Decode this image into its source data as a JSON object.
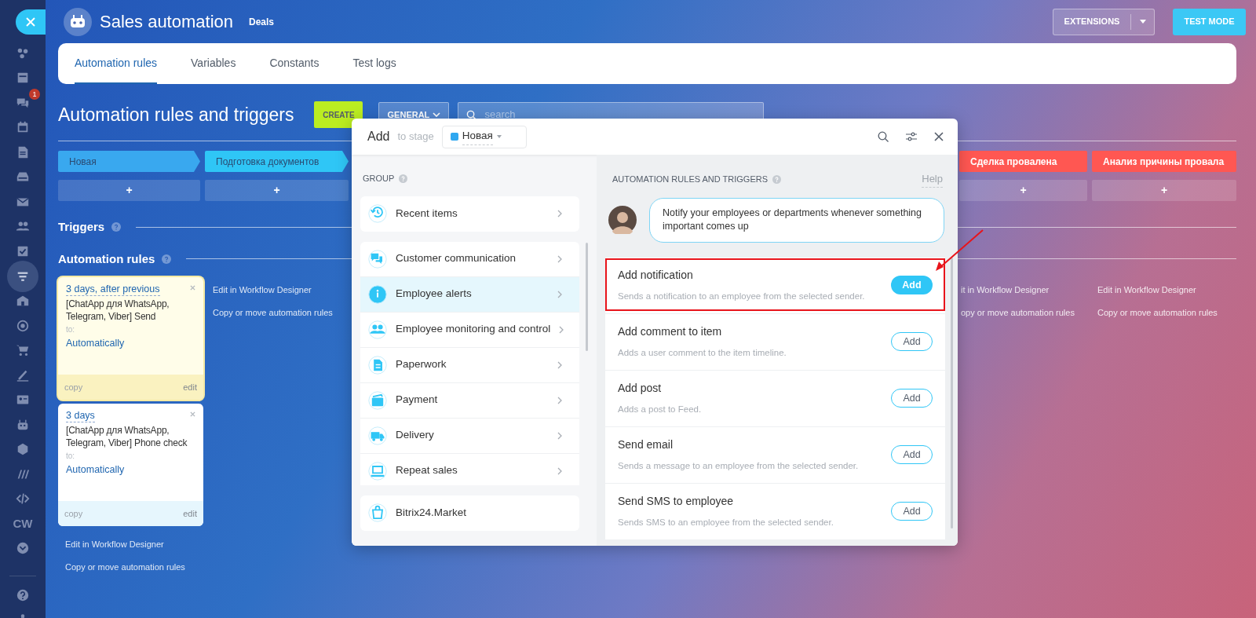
{
  "sidebar": {
    "items": [
      {
        "selected": false
      },
      {
        "selected": false
      },
      {
        "selected": false,
        "badge": "1"
      },
      {
        "selected": false
      },
      {
        "selected": false
      },
      {
        "selected": false
      },
      {
        "selected": false
      },
      {
        "selected": false
      },
      {
        "selected": false
      },
      {
        "selected": true
      },
      {
        "selected": false
      },
      {
        "selected": false
      },
      {
        "selected": false
      },
      {
        "selected": false
      },
      {
        "selected": false
      },
      {
        "selected": false
      },
      {
        "selected": false
      },
      {
        "selected": false
      },
      {
        "selected": false
      },
      {
        "selected": false,
        "label": "CW"
      },
      {
        "selected": false
      },
      {
        "selected": false
      },
      {
        "selected": false
      }
    ]
  },
  "header": {
    "title": "Sales automation",
    "subtitle": "Deals",
    "extensions": "EXTENSIONS",
    "test_mode": "TEST MODE"
  },
  "tabs": [
    {
      "label": "Automation rules",
      "selected": true
    },
    {
      "label": "Variables",
      "selected": false
    },
    {
      "label": "Constants",
      "selected": false
    },
    {
      "label": "Test logs",
      "selected": false
    }
  ],
  "toolbar": {
    "heading": "Automation rules and triggers",
    "create": "CREATE",
    "filter": "GENERAL",
    "search_placeholder": "search"
  },
  "stages_left": [
    {
      "name": "Новая",
      "color": "#39a8ef",
      "add": "+"
    },
    {
      "name": "Подготовка документов",
      "color": "#2fc6f6",
      "add": "+"
    }
  ],
  "stages_right": [
    {
      "name": "Сделка провалена",
      "color": "#ff5752",
      "add": "+"
    },
    {
      "name": "Анализ причины провала",
      "color": "#ff5752",
      "add": "+"
    }
  ],
  "sections": {
    "triggers": "Triggers",
    "rules": "Automation rules"
  },
  "rules": [
    {
      "delay": "3 days, after previous",
      "title": "[ChatApp для WhatsApp, Telegram, Viber] Send",
      "to_label": "to:",
      "responsible": "Automatically",
      "copy": "copy",
      "edit": "edit",
      "highlighted": true
    },
    {
      "delay": "3 days",
      "title": "[ChatApp для WhatsApp, Telegram, Viber] Phone check",
      "to_label": "to:",
      "responsible": "Automatically",
      "copy": "copy",
      "edit": "edit",
      "highlighted": false
    }
  ],
  "rule_links_first_column": [
    "Edit in Workflow Designer",
    "Copy or move automation rules"
  ],
  "rule_links_second_column": [
    "Edit in Workflow Designer",
    "Copy or move automation rules"
  ],
  "rule_links_right_columns": [
    [
      "it in Workflow Designer",
      "opy or move automation rules"
    ],
    [
      "Edit in Workflow Designer",
      "Copy or move automation rules"
    ]
  ],
  "modal": {
    "title": "Add",
    "stage_label": "to stage",
    "stage": {
      "name": "Новая",
      "color": "#2fa7f0"
    },
    "group_heading": "GROUP",
    "recent": {
      "label": "Recent items"
    },
    "groups": [
      {
        "label": "Customer communication",
        "selected": false
      },
      {
        "label": "Employee alerts",
        "selected": true
      },
      {
        "label": "Employee monitoring and control",
        "selected": false
      },
      {
        "label": "Paperwork",
        "selected": false
      },
      {
        "label": "Payment",
        "selected": false
      },
      {
        "label": "Delivery",
        "selected": false
      },
      {
        "label": "Repeat sales",
        "selected": false
      }
    ],
    "market": {
      "label": "Bitrix24.Market"
    },
    "actions_heading": "AUTOMATION RULES AND TRIGGERS",
    "help": "Help",
    "tip": "Notify your employees or departments whenever something important comes up",
    "actions": [
      {
        "title": "Add notification",
        "description": "Sends a notification to an employee from the selected sender.",
        "button": "Add",
        "primary": true,
        "annotated": true
      },
      {
        "title": "Add comment to item",
        "description": "Adds a user comment to the item timeline.",
        "button": "Add",
        "primary": false,
        "annotated": false
      },
      {
        "title": "Add post",
        "description": "Adds a post to Feed.",
        "button": "Add",
        "primary": false,
        "annotated": false
      },
      {
        "title": "Send email",
        "description": "Sends a message to an employee from the selected sender.",
        "button": "Add",
        "primary": false,
        "annotated": false
      },
      {
        "title": "Send SMS to employee",
        "description": "Sends SMS to an employee from the selected sender.",
        "button": "Add",
        "primary": false,
        "annotated": false
      }
    ]
  }
}
